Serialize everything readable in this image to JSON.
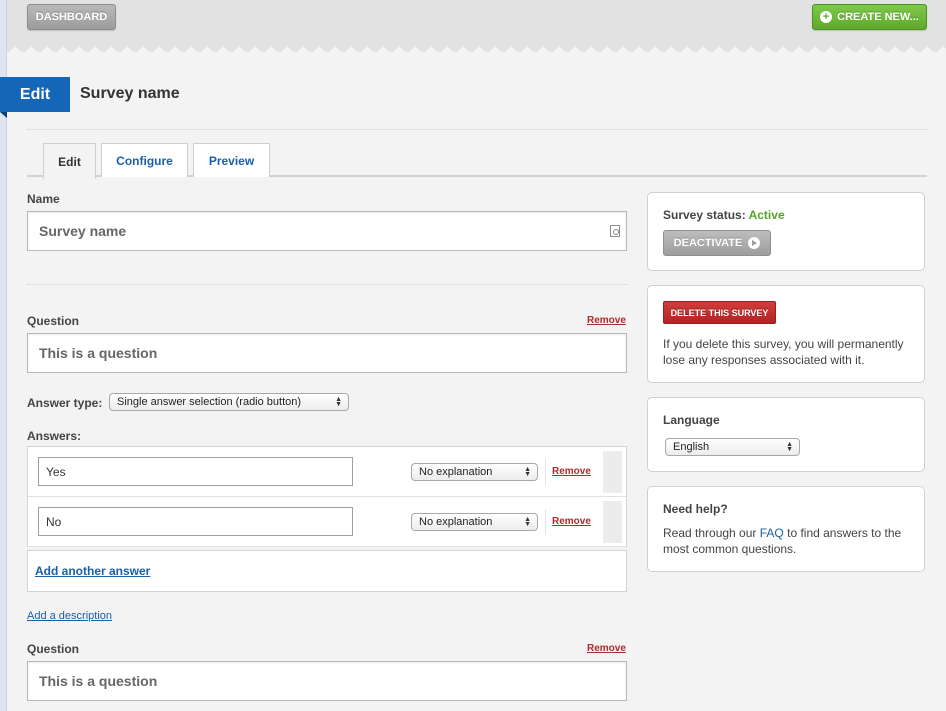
{
  "topbar": {
    "dashboard_label": "DASHBOARD",
    "create_label": "CREATE NEW..."
  },
  "header": {
    "mode_label": "Edit",
    "title": "Survey name"
  },
  "tabs": [
    {
      "label": "Edit",
      "active": true
    },
    {
      "label": "Configure",
      "active": false
    },
    {
      "label": "Preview",
      "active": false
    }
  ],
  "form": {
    "name_label": "Name",
    "name_value": "Survey name",
    "questions": [
      {
        "label": "Question",
        "remove_label": "Remove",
        "value": "This is a question"
      },
      {
        "label": "Question",
        "remove_label": "Remove",
        "value": "This is a question"
      }
    ],
    "answer_type_label": "Answer type:",
    "answer_type_value": "Single answer selection (radio button)",
    "answers_label": "Answers:",
    "answers": [
      {
        "value": "Yes",
        "explanation": "No explanation",
        "remove_label": "Remove"
      },
      {
        "value": "No",
        "explanation": "No explanation",
        "remove_label": "Remove"
      }
    ],
    "add_answer_label": "Add another answer",
    "add_description_label": "Add a description"
  },
  "sidebar": {
    "status": {
      "label": "Survey status:",
      "value": "Active",
      "value_color": "#5aa02c",
      "deactivate_label": "DEACTIVATE"
    },
    "delete": {
      "button_label": "DELETE THIS SURVEY",
      "text": "If you delete this survey, you will permanently lose any responses associated with it."
    },
    "language": {
      "label": "Language",
      "value": "English"
    },
    "help": {
      "title": "Need help?",
      "text_before": "Read through our",
      "link": "FAQ",
      "text_after": "to find answers to the most common questions."
    }
  },
  "colors": {
    "accent": "#1467b8",
    "create": "#5ea92b",
    "danger": "#b22424"
  }
}
